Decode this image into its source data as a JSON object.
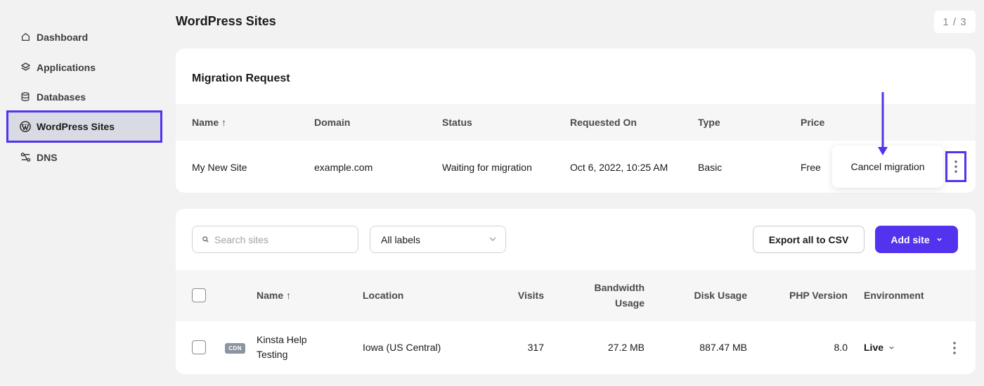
{
  "sidebar": {
    "items": [
      {
        "label": "Dashboard",
        "icon": "home-icon"
      },
      {
        "label": "Applications",
        "icon": "layers-icon"
      },
      {
        "label": "Databases",
        "icon": "database-icon"
      },
      {
        "label": "WordPress Sites",
        "icon": "wordpress-icon",
        "active": true
      },
      {
        "label": "DNS",
        "icon": "dns-icon"
      }
    ]
  },
  "header": {
    "title": "WordPress Sites",
    "pager": "1 / 3"
  },
  "migration": {
    "title": "Migration Request",
    "columns": [
      "Name ↑",
      "Domain",
      "Status",
      "Requested On",
      "Type",
      "Price"
    ],
    "row": {
      "name": "My New Site",
      "domain": "example.com",
      "status": "Waiting for migration",
      "requested_on": "Oct 6, 2022, 10:25 AM",
      "type": "Basic",
      "price": "Free"
    },
    "action_label": "Cancel migration"
  },
  "sites": {
    "search_placeholder": "Search sites",
    "label_filter": "All labels",
    "export_label": "Export all to CSV",
    "add_label": "Add site",
    "columns": {
      "name": "Name ↑",
      "location": "Location",
      "visits": "Visits",
      "bandwidth_1": "Bandwidth",
      "bandwidth_2": "Usage",
      "disk": "Disk Usage",
      "php": "PHP Version",
      "env": "Environment"
    },
    "row": {
      "badge": "CDN",
      "name_1": "Kinsta Help",
      "name_2": "Testing",
      "location": "Iowa (US Central)",
      "visits": "317",
      "bandwidth": "27.2 MB",
      "disk": "887.47 MB",
      "php": "8.0",
      "env": "Live"
    }
  },
  "colors": {
    "accent": "#5333ed",
    "background": "#f2f2f3"
  }
}
